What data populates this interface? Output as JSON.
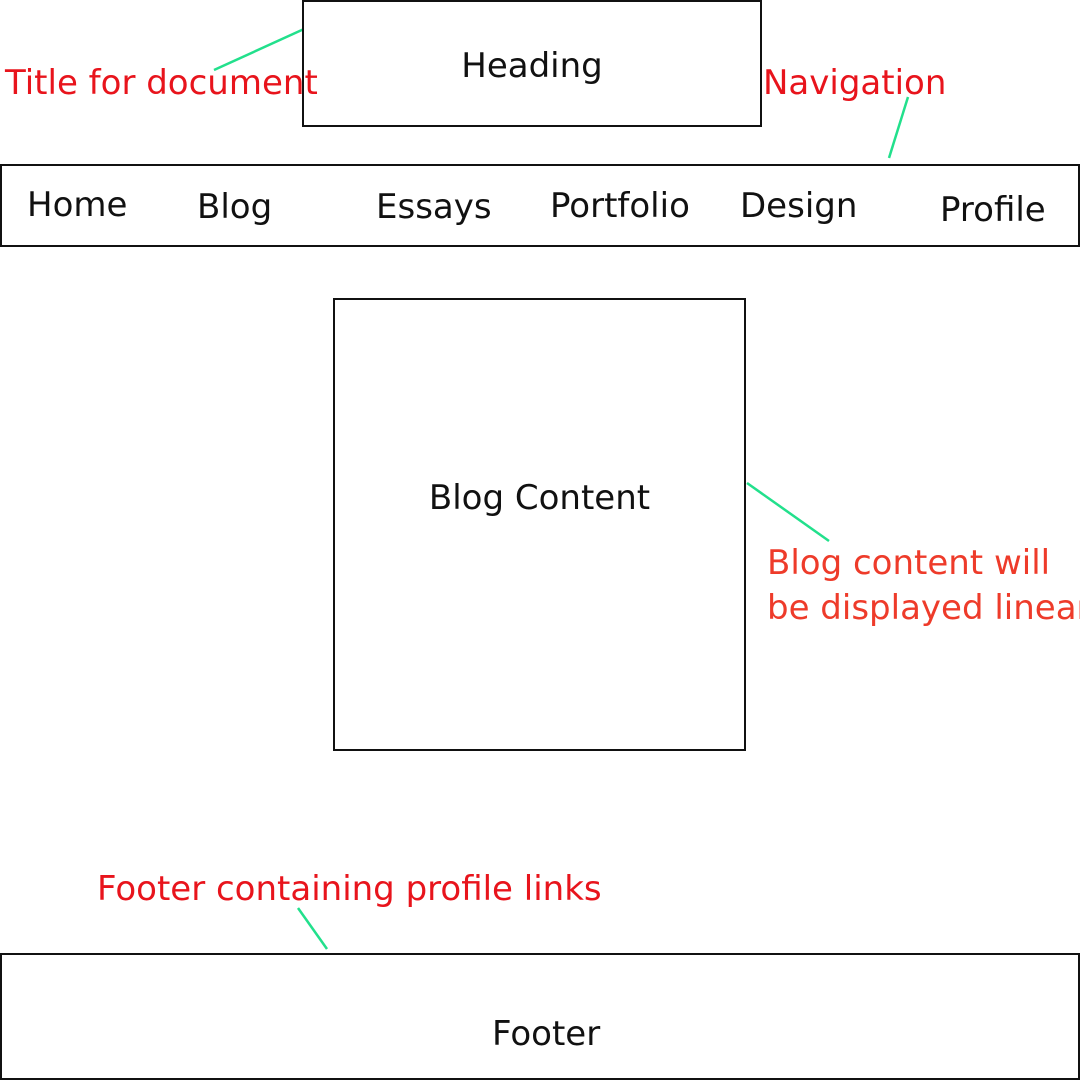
{
  "heading": {
    "label": "Heading"
  },
  "navigation": {
    "items": [
      "Home",
      "Blog",
      "Essays",
      "Portfolio",
      "Design",
      "Profile"
    ]
  },
  "content": {
    "label": "Blog Content"
  },
  "footer": {
    "label": "Footer"
  },
  "annotations": {
    "title": "Title for document",
    "navigation": "Navigation",
    "content_line1": "Blog content will",
    "content_line2": "be displayed linear",
    "footer": "Footer containing profile links"
  },
  "colors": {
    "annotation_text": "#e8141c",
    "content_annotation_text": "#ee3b2a",
    "connector": "#22e08c",
    "box_border": "#111111"
  }
}
